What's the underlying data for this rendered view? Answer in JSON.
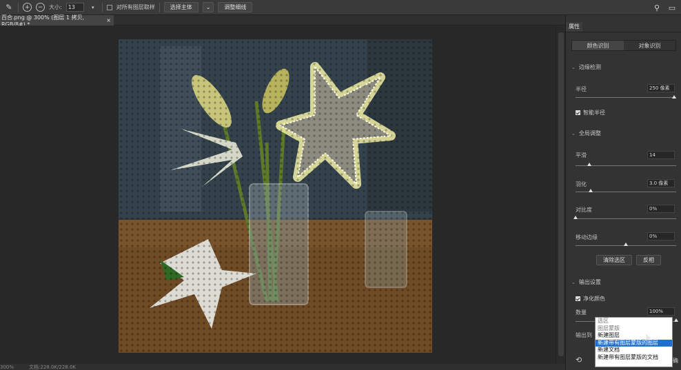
{
  "options_bar": {
    "size_label": "大小:",
    "size_value": "13",
    "sample_all_label": "对所有图层取样",
    "select_subject_label": "选择主体",
    "refine_hair_label": "调整细线"
  },
  "document_tab": {
    "title": "百合.png @ 300% (图层 1 拷贝, RGB/8#) *",
    "close": "×"
  },
  "status_bar": {
    "zoom": "300%",
    "doc_info": "文档:228.0K/228.0K"
  },
  "properties": {
    "tab_label": "属性",
    "mode_tabs": [
      "颜色识别",
      "对象识别"
    ],
    "edge_detection": {
      "title": "边缘检测",
      "radius_label": "半径",
      "radius_value": "250 像素",
      "radius_fraction": 0.98,
      "smart_radius_label": "智能半径"
    },
    "global_refine": {
      "title": "全局调整",
      "smooth_label": "平滑",
      "smooth_value": "14",
      "smooth_fraction": 0.14,
      "feather_label": "羽化",
      "feather_value": "3.0 像素",
      "feather_fraction": 0.15,
      "contrast_label": "对比度",
      "contrast_value": "0%",
      "contrast_fraction": 0.0,
      "shift_edge_label": "移动边缘",
      "shift_edge_value": "0%",
      "shift_edge_fraction": 0.5,
      "clear_selection_label": "清除选区",
      "invert_label": "反相"
    },
    "output": {
      "title": "输出设置",
      "decontaminate_label": "净化颜色",
      "amount_label": "数量",
      "amount_value": "100%",
      "amount_fraction": 1.0,
      "output_to_label": "输出到",
      "partial_label": "确"
    }
  },
  "output_dropdown": {
    "options": [
      "选区",
      "图层蒙版",
      "新建图层",
      "新建带有图层蒙版的图层",
      "新建文档",
      "新建带有图层蒙版的文档"
    ],
    "disabled": [
      true,
      true,
      false,
      false,
      false,
      false
    ],
    "highlighted_index": 3
  },
  "colors": {
    "selection_glow": "#f3f0a6",
    "dropdown_highlight": "#1f6fd1"
  }
}
